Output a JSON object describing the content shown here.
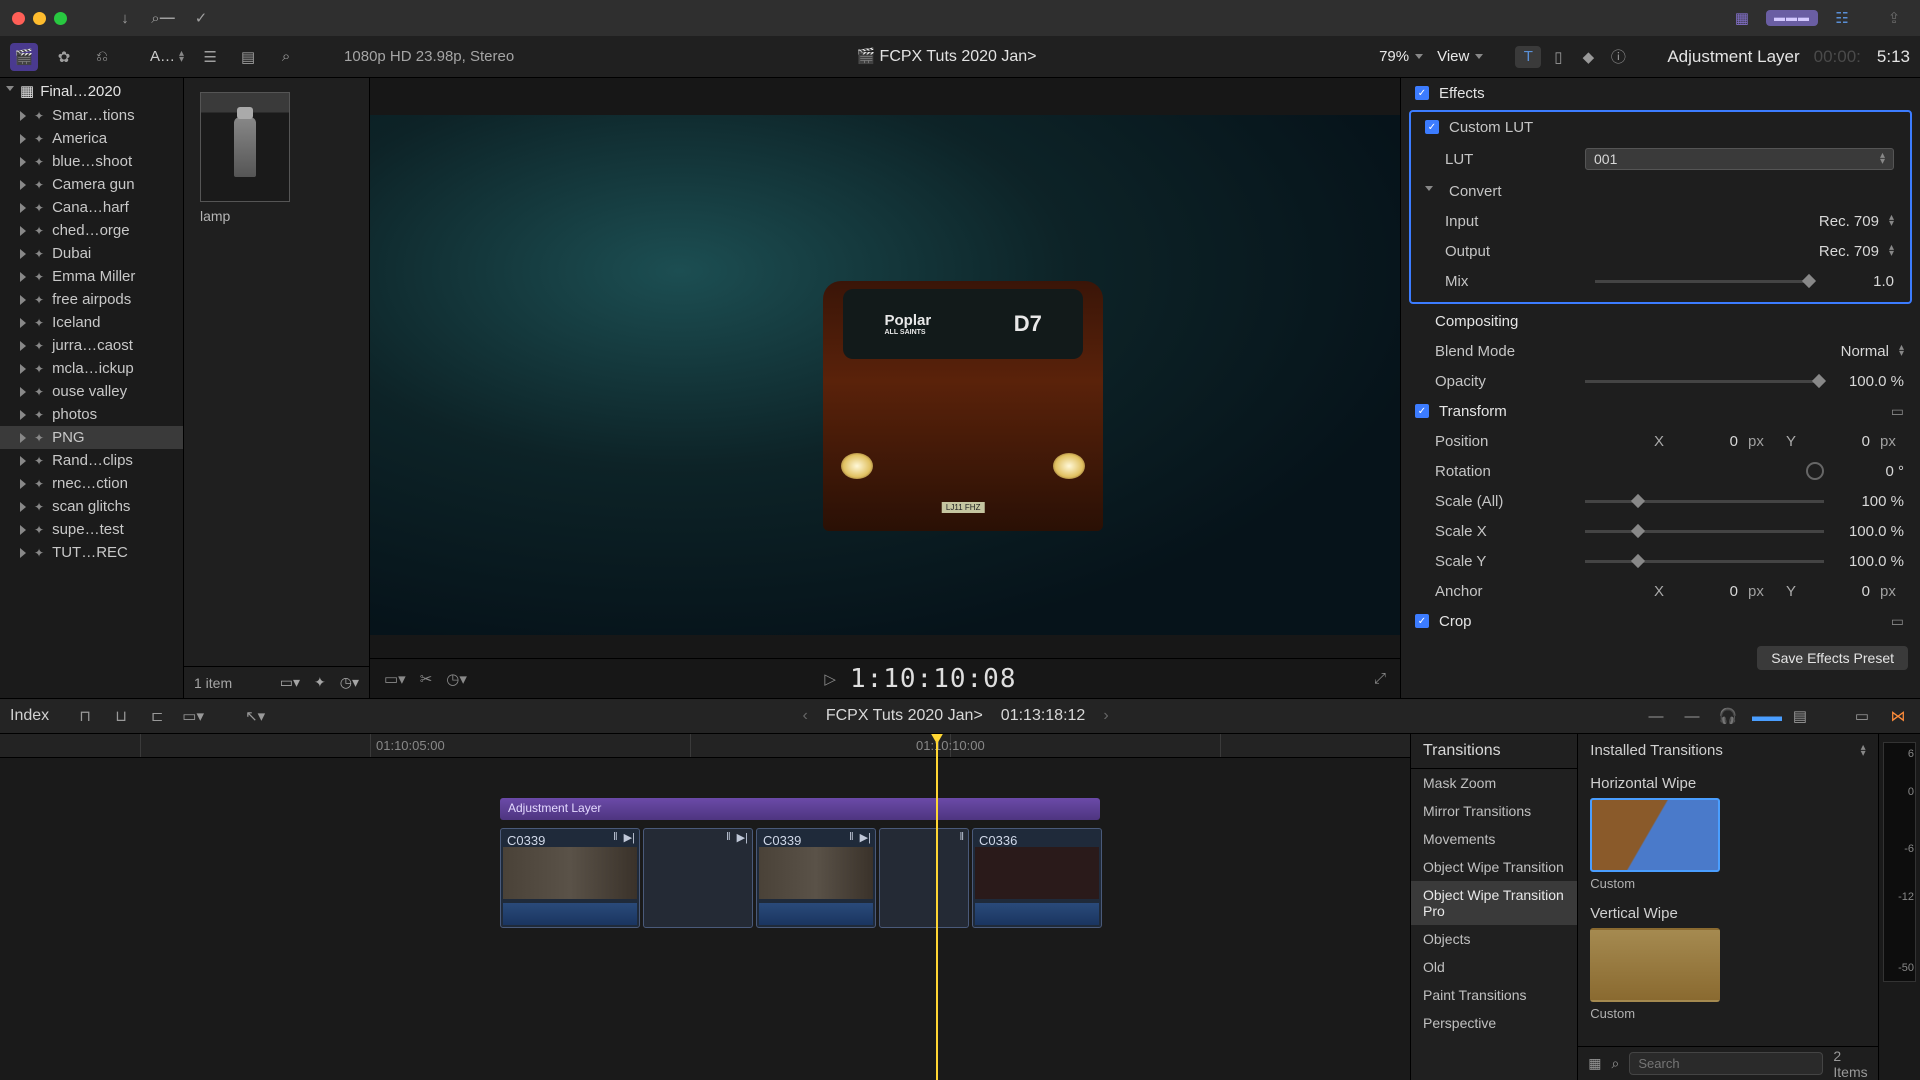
{
  "titlebar": {
    "share": "⇪"
  },
  "topstrip": {
    "fontmenu": "A…",
    "format": "1080p HD 23.98p, Stereo",
    "project": "FCPX Tuts 2020 Jan>",
    "zoom": "79%",
    "view": "View",
    "inspector_title": "Adjustment Layer",
    "tc_dim": "00:00:",
    "duration": "5:13"
  },
  "sidebar": {
    "library": "Final…2020",
    "items": [
      "Smar…tions",
      "America",
      "blue…shoot",
      "Camera gun",
      "Cana…harf",
      "ched…orge",
      "Dubai",
      "Emma Miller",
      "free airpods",
      "Iceland",
      "jurra…caost",
      "mcla…ickup",
      "ouse valley",
      "photos",
      "PNG",
      "Rand…clips",
      "rnec…ction",
      "scan glitchs",
      "supe…test",
      "TUT…REC"
    ],
    "selected_index": 14
  },
  "browser": {
    "clip_name": "lamp",
    "count": "1 item"
  },
  "viewer": {
    "bus_dest": "Poplar",
    "bus_dest2": "ALL SAINTS",
    "bus_num": "D7",
    "bus_plate": "LJ11 FHZ",
    "timecode": "1:10:10:08"
  },
  "inspector": {
    "effects_label": "Effects",
    "customlut_label": "Custom LUT",
    "lut_label": "LUT",
    "lut_value": "001",
    "convert_label": "Convert",
    "input_label": "Input",
    "input_value": "Rec. 709",
    "output_label": "Output",
    "output_value": "Rec. 709",
    "mix_label": "Mix",
    "mix_value": "1.0",
    "compositing_label": "Compositing",
    "blend_label": "Blend Mode",
    "blend_value": "Normal",
    "opacity_label": "Opacity",
    "opacity_value": "100.0 %",
    "transform_label": "Transform",
    "position_label": "Position",
    "position_x": "0",
    "position_y": "0",
    "px": "px",
    "rotation_label": "Rotation",
    "rotation_value": "0 °",
    "scaleall_label": "Scale (All)",
    "scaleall_value": "100 %",
    "scalex_label": "Scale X",
    "scalex_value": "100.0 %",
    "scaley_label": "Scale Y",
    "scaley_value": "100.0 %",
    "anchor_label": "Anchor",
    "anchor_x": "0",
    "anchor_y": "0",
    "crop_label": "Crop",
    "save_preset": "Save Effects Preset"
  },
  "tlstrip": {
    "index": "Index",
    "project": "FCPX Tuts 2020 Jan>",
    "duration": "01:13:18:12"
  },
  "timeline": {
    "tc1": "01:10:05:00",
    "tc2": "01:10:10:00",
    "adj_label": "Adjustment Layer",
    "clip1": "C0339",
    "clip3": "C0339",
    "clip5": "C0336"
  },
  "transitions": {
    "header": "Transitions",
    "installed": "Installed Transitions",
    "cats": [
      "Mask Zoom",
      "Mirror Transitions",
      "Movements",
      "Object Wipe Transition",
      "Object Wipe Transition Pro",
      "Objects",
      "Old",
      "Paint Transitions",
      "Perspective"
    ],
    "selected_cat": 4,
    "item1_name": "Horizontal Wipe",
    "item1_sub": "Custom",
    "item2_name": "Vertical Wipe",
    "item2_sub": "Custom",
    "search_placeholder": "Search",
    "count": "2 Items"
  },
  "meters": {
    "ticks": [
      "6",
      "0",
      "-6",
      "-12",
      "-50"
    ]
  }
}
